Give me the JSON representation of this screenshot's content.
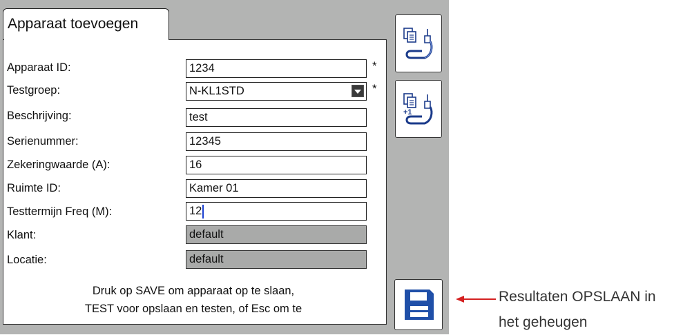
{
  "dialog": {
    "tab_title": "Apparaat toevoegen",
    "fields": [
      {
        "label": "Apparaat ID:",
        "value": "1234",
        "required_mark": "*"
      },
      {
        "label": "Testgroep:",
        "value": "N-KL1STD",
        "required_mark": "*"
      },
      {
        "label": "Beschrijving:",
        "value": "test"
      },
      {
        "label": "Serienummer:",
        "value": "12345"
      },
      {
        "label": "Zekeringwaarde (A):",
        "value": "16"
      },
      {
        "label": "Ruimte ID:",
        "value": "Kamer 01"
      },
      {
        "label": "Testtermijn Freq (M):",
        "value": "12"
      },
      {
        "label": "Klant:",
        "value": "default"
      },
      {
        "label": "Locatie:",
        "value": "default"
      }
    ],
    "hint_line1": "Druk op SAVE om apparaat op te slaan,",
    "hint_line2": "TEST voor opslaan en testen, of Esc om te"
  },
  "side_buttons": {
    "top_icon": "copy-appliance-icon",
    "middle_icon": "copy-appliance-plus-one-icon",
    "middle_badge": "+1",
    "save_icon": "floppy-disk-icon"
  },
  "callout": {
    "line1": "Resultaten OPSLAAN in",
    "line2": "het geheugen",
    "arrow_color": "#d42020"
  },
  "colors": {
    "bezel": "#b3b4b3",
    "readonly_field": "#a9aaa9",
    "save_icon": "#1f4fa8"
  }
}
